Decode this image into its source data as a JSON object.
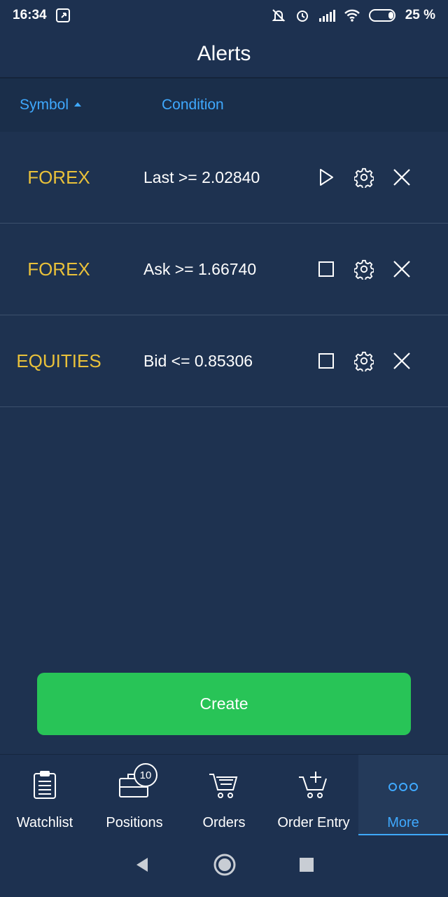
{
  "status_bar": {
    "time": "16:34",
    "battery": "25 %"
  },
  "header": {
    "title": "Alerts"
  },
  "columns": {
    "symbol": "Symbol",
    "condition": "Condition"
  },
  "alerts": [
    {
      "symbol": "FOREX",
      "condition": "Last >= 2.02840",
      "state": "paused",
      "icon": "play-icon"
    },
    {
      "symbol": "FOREX",
      "condition": "Ask >= 1.66740",
      "state": "active",
      "icon": "stop-icon"
    },
    {
      "symbol": "EQUITIES",
      "condition": "Bid <= 0.85306",
      "state": "active",
      "icon": "stop-icon"
    }
  ],
  "create_label": "Create",
  "tabs": [
    {
      "label": "Watchlist",
      "icon": "clipboard-icon"
    },
    {
      "label": "Positions",
      "icon": "briefcase-icon",
      "badge": "10"
    },
    {
      "label": "Orders",
      "icon": "cart-icon"
    },
    {
      "label": "Order Entry",
      "icon": "cart-add-icon"
    },
    {
      "label": "More",
      "icon": "more-icon",
      "active": true
    }
  ],
  "colors": {
    "background": "#1e3250",
    "accent": "#3fa9ff",
    "symbol": "#e9c13a",
    "create": "#28c457"
  }
}
